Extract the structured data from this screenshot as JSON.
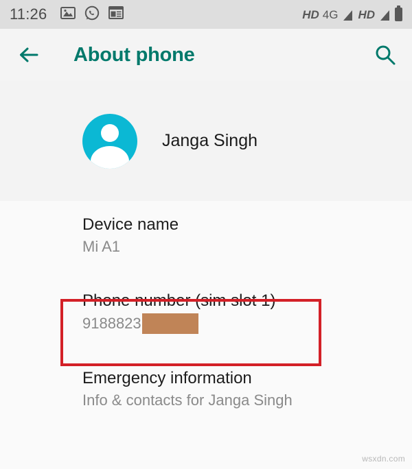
{
  "status_bar": {
    "time": "11:26",
    "left_icons": [
      "image-icon",
      "whatsapp-icon",
      "news-icon"
    ],
    "right_icons": [
      "hd-icon",
      "network-4g-label",
      "signal-icon",
      "hd-icon-2",
      "signal-icon-2",
      "battery-icon"
    ],
    "hd_label": "HD",
    "network_label": "4G",
    "hd_label_2": "HD",
    "background_color": "#dedede"
  },
  "app_bar": {
    "back_icon": "arrow-left-icon",
    "title": "About phone",
    "search_icon": "search-icon",
    "accent_color": "#00796b"
  },
  "profile": {
    "avatar_icon": "person-avatar-icon",
    "avatar_color": "#0bb8d4",
    "name": "Janga Singh"
  },
  "settings": {
    "items": [
      {
        "title": "Device name",
        "subtitle": "Mi A1",
        "redacted": false,
        "highlighted": false
      },
      {
        "title": "Phone number (sim slot 1)",
        "subtitle": "9188823",
        "redacted": true,
        "redaction_color": "#c08457",
        "highlighted": true
      },
      {
        "title": "Emergency information",
        "subtitle": "Info & contacts for Janga Singh",
        "redacted": false,
        "highlighted": false
      }
    ]
  },
  "annotation": {
    "highlight_color": "#d32027"
  },
  "watermark": {
    "text": "wsxdn.com"
  }
}
